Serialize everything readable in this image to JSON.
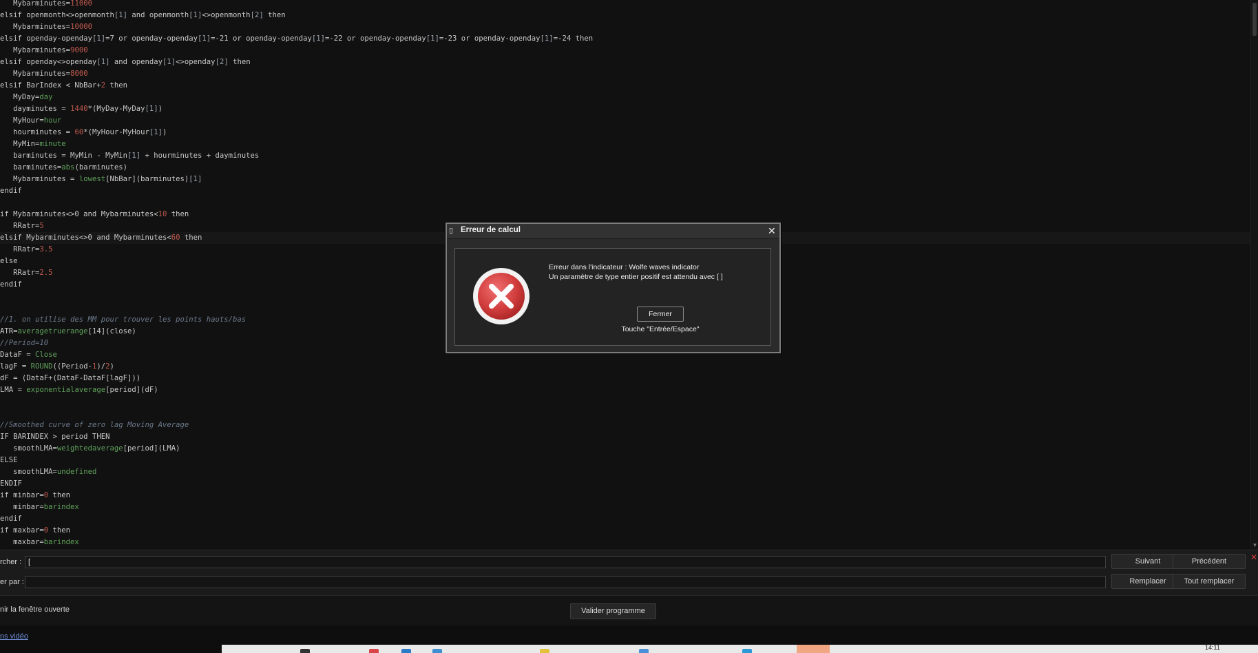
{
  "editor": {
    "lines": [
      [
        {
          "t": "   Mybarminutes="
        },
        {
          "t": "11000",
          "c": "num"
        }
      ],
      [
        {
          "t": "elsif openmonth<>openmonth"
        },
        {
          "t": "[1]",
          "c": "br"
        },
        {
          "t": " and openmonth"
        },
        {
          "t": "[1]",
          "c": "br"
        },
        {
          "t": "<>openmonth"
        },
        {
          "t": "[2]",
          "c": "br"
        },
        {
          "t": " then"
        }
      ],
      [
        {
          "t": "   Mybarminutes="
        },
        {
          "t": "10000",
          "c": "num"
        }
      ],
      [
        {
          "t": "elsif openday-openday"
        },
        {
          "t": "[1]",
          "c": "br"
        },
        {
          "t": "=7 or openday-openday"
        },
        {
          "t": "[1]",
          "c": "br"
        },
        {
          "t": "=-21 or openday-openday"
        },
        {
          "t": "[1]",
          "c": "br"
        },
        {
          "t": "=-22 or openday-openday"
        },
        {
          "t": "[1]",
          "c": "br"
        },
        {
          "t": "=-23 or openday-openday"
        },
        {
          "t": "[1]",
          "c": "br"
        },
        {
          "t": "=-24 then"
        }
      ],
      [
        {
          "t": "   Mybarminutes="
        },
        {
          "t": "9000",
          "c": "num"
        }
      ],
      [
        {
          "t": "elsif openday<>openday"
        },
        {
          "t": "[1]",
          "c": "br"
        },
        {
          "t": " and openday"
        },
        {
          "t": "[1]",
          "c": "br"
        },
        {
          "t": "<>openday"
        },
        {
          "t": "[2]",
          "c": "br"
        },
        {
          "t": " then"
        }
      ],
      [
        {
          "t": "   Mybarminutes="
        },
        {
          "t": "8000",
          "c": "num"
        }
      ],
      [
        {
          "t": "elsif BarIndex < NbBar+"
        },
        {
          "t": "2",
          "c": "num"
        },
        {
          "t": " then"
        }
      ],
      [
        {
          "t": "   MyDay="
        },
        {
          "t": "day",
          "c": "fn"
        }
      ],
      [
        {
          "t": "   dayminutes = "
        },
        {
          "t": "1440",
          "c": "num"
        },
        {
          "t": "*(MyDay-MyDay"
        },
        {
          "t": "[1]",
          "c": "br"
        },
        {
          "t": ")"
        }
      ],
      [
        {
          "t": "   MyHour="
        },
        {
          "t": "hour",
          "c": "fn"
        }
      ],
      [
        {
          "t": "   hourminutes = "
        },
        {
          "t": "60",
          "c": "num"
        },
        {
          "t": "*(MyHour-MyHour"
        },
        {
          "t": "[1]",
          "c": "br"
        },
        {
          "t": ")"
        }
      ],
      [
        {
          "t": "   MyMin="
        },
        {
          "t": "minute",
          "c": "fn"
        }
      ],
      [
        {
          "t": "   barminutes = MyMin - MyMin"
        },
        {
          "t": "[1]",
          "c": "br"
        },
        {
          "t": " + hourminutes + dayminutes"
        }
      ],
      [
        {
          "t": "   barminutes="
        },
        {
          "t": "abs",
          "c": "fn"
        },
        {
          "t": "(barminutes)"
        }
      ],
      [
        {
          "t": "   Mybarminutes = "
        },
        {
          "t": "lowest",
          "c": "fn"
        },
        {
          "t": "[NbBar](barminutes)"
        },
        {
          "t": "[1]",
          "c": "br"
        }
      ],
      [
        {
          "t": "endif"
        }
      ],
      [
        {
          "t": ""
        }
      ],
      [
        {
          "t": "if Mybarminutes<>0 and Mybarminutes<"
        },
        {
          "t": "10",
          "c": "num"
        },
        {
          "t": " then"
        }
      ],
      [
        {
          "t": "   RRatr="
        },
        {
          "t": "5",
          "c": "num"
        }
      ],
      [
        {
          "t": "elsif Mybarminutes<>0 and Mybarminutes<"
        },
        {
          "t": "60",
          "c": "num"
        },
        {
          "t": " then"
        }
      ],
      [
        {
          "t": "   RRatr="
        },
        {
          "t": "3.5",
          "c": "num"
        }
      ],
      [
        {
          "t": "else"
        }
      ],
      [
        {
          "t": "   RRatr="
        },
        {
          "t": "2.5",
          "c": "num"
        }
      ],
      [
        {
          "t": "endif"
        }
      ],
      [
        {
          "t": ""
        }
      ],
      [
        {
          "t": ""
        }
      ],
      [
        {
          "t": "//1. on utilise des MM pour trouver les points hauts/bas",
          "c": "cmt"
        }
      ],
      [
        {
          "t": "ATR="
        },
        {
          "t": "averagetruerange",
          "c": "fn"
        },
        {
          "t": "[14](close)"
        }
      ],
      [
        {
          "t": "//Period=10",
          "c": "cmt"
        }
      ],
      [
        {
          "t": "DataF = "
        },
        {
          "t": "Close",
          "c": "fn"
        }
      ],
      [
        {
          "t": "lagF = "
        },
        {
          "t": "ROUND",
          "c": "fn"
        },
        {
          "t": "((Period-"
        },
        {
          "t": "1",
          "c": "num"
        },
        {
          "t": ")/"
        },
        {
          "t": "2",
          "c": "num"
        },
        {
          "t": ")"
        }
      ],
      [
        {
          "t": "dF = (DataF+(DataF-DataF[lagF]))"
        }
      ],
      [
        {
          "t": "LMA = "
        },
        {
          "t": "exponentialaverage",
          "c": "fn"
        },
        {
          "t": "[period](dF)"
        }
      ],
      [
        {
          "t": ""
        }
      ],
      [
        {
          "t": ""
        }
      ],
      [
        {
          "t": "//Smoothed curve of zero lag Moving Average",
          "c": "cmt"
        }
      ],
      [
        {
          "t": "IF BARINDEX > period THEN"
        }
      ],
      [
        {
          "t": "   smoothLMA="
        },
        {
          "t": "weightedaverage",
          "c": "fn"
        },
        {
          "t": "[period](LMA)"
        }
      ],
      [
        {
          "t": "ELSE"
        }
      ],
      [
        {
          "t": "   smoothLMA="
        },
        {
          "t": "undefined",
          "c": "fn"
        }
      ],
      [
        {
          "t": "ENDIF"
        }
      ],
      [
        {
          "t": "if minbar="
        },
        {
          "t": "0",
          "c": "num"
        },
        {
          "t": " then"
        }
      ],
      [
        {
          "t": "   minbar="
        },
        {
          "t": "barindex",
          "c": "fn"
        }
      ],
      [
        {
          "t": "endif"
        }
      ],
      [
        {
          "t": "if maxbar="
        },
        {
          "t": "0",
          "c": "num"
        },
        {
          "t": " then"
        }
      ],
      [
        {
          "t": "   maxbar="
        },
        {
          "t": "barindex",
          "c": "fn"
        }
      ]
    ]
  },
  "find_replace": {
    "search_label": "rcher :",
    "search_value": "[",
    "replace_label": "er par :",
    "replace_value": "",
    "next_button": "Suivant",
    "previous_button": "Précédent",
    "replace_button": "Remplacer",
    "replace_all_button": "Tout remplacer",
    "close_glyph": "✕"
  },
  "bottom_bar": {
    "keep_open_label": "nir la fenêtre ouverte",
    "validate_button": "Valider programme",
    "video_link": "ns vidéo"
  },
  "taskbar": {
    "clock": "14:11"
  },
  "dialog": {
    "title": "Erreur de calcul",
    "close_glyph": "✕",
    "message_line1": "Erreur dans l'indicateur : Wolfe waves indicator",
    "message_line2": "Un paramètre de type entier positif est attendu avec [ ]",
    "close_button": "Fermer",
    "shortcut_hint": "Touche \"Entrée/Espace\""
  },
  "colors": {
    "keyword": "#c8c8c8",
    "number": "#c05a4e",
    "function": "#5fa05a",
    "comment": "#6c7a8c",
    "error_icon": "#d24545",
    "link": "#6f8fd8"
  }
}
